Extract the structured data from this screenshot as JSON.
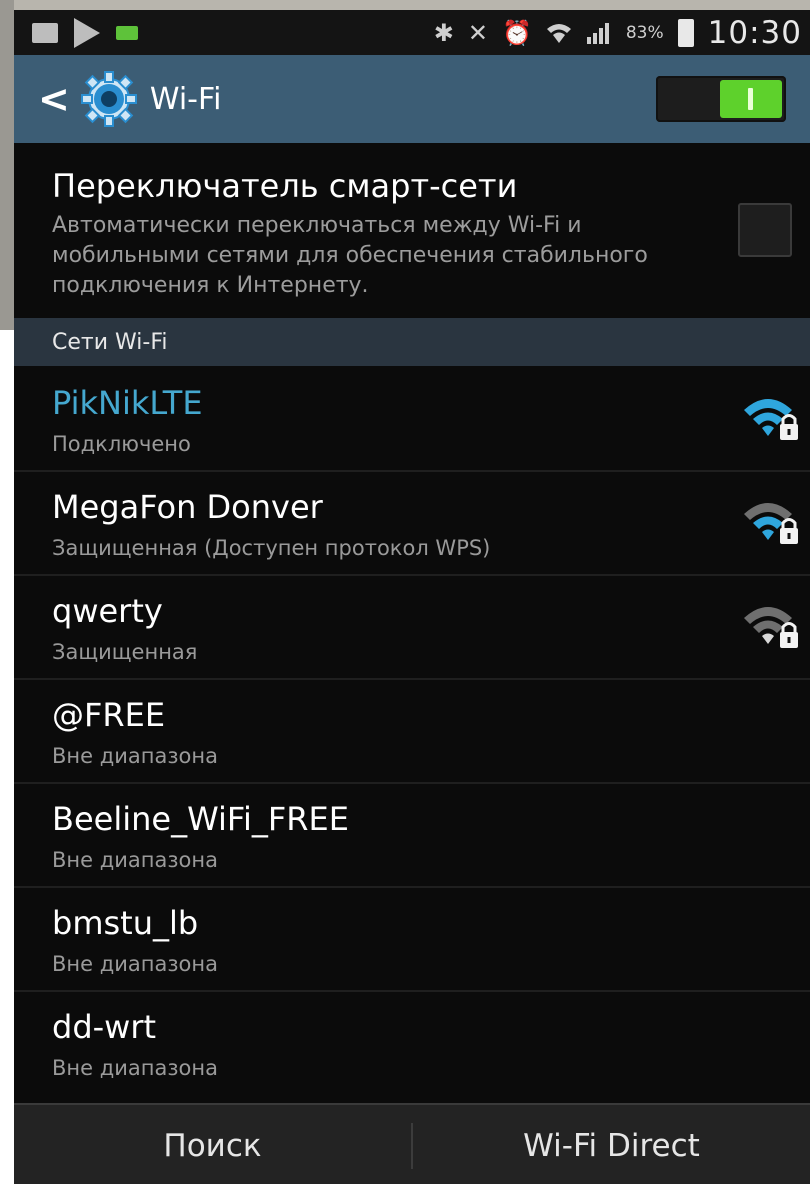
{
  "status_bar": {
    "battery_percent": "83%",
    "time": "10:30",
    "left_icons": [
      "screenshot-icon",
      "play-icon",
      "battery-charge-icon"
    ],
    "right_icons": [
      "bluetooth-icon",
      "mute-icon",
      "alarm-icon",
      "wifi-status-icon",
      "signal-icon"
    ]
  },
  "action_bar": {
    "title": "Wi-Fi",
    "wifi_enabled": true,
    "accent_color": "#3c5d75",
    "toggle_on_color": "#5ed12c"
  },
  "smart_switch": {
    "title": "Переключатель смарт-сети",
    "description": "Автоматически переключаться между Wi-Fi и мобильными сетями для обеспечения стабильного подключения к Интернету.",
    "checked": false
  },
  "section_header": "Сети Wi-Fi",
  "networks": [
    {
      "name": "PikNikLTE",
      "status": "Подключено",
      "connected": true,
      "signal_icon": true
    },
    {
      "name": "MegaFon Donver",
      "status": "Защищенная (Доступен протокол WPS)",
      "connected": false,
      "signal_icon": true
    },
    {
      "name": "qwerty",
      "status": "Защищенная",
      "connected": false,
      "signal_icon": true
    },
    {
      "name": "@FREE",
      "status": "Вне диапазона",
      "connected": false,
      "signal_icon": false
    },
    {
      "name": "Beeline_WiFi_FREE",
      "status": "Вне диапазона",
      "connected": false,
      "signal_icon": false
    },
    {
      "name": "bmstu_lb",
      "status": "Вне диапазона",
      "connected": false,
      "signal_icon": false
    },
    {
      "name": "dd-wrt",
      "status": "Вне диапазона",
      "connected": false,
      "signal_icon": false
    }
  ],
  "bottom_bar": {
    "search_label": "Поиск",
    "wifi_direct_label": "Wi-Fi Direct"
  }
}
